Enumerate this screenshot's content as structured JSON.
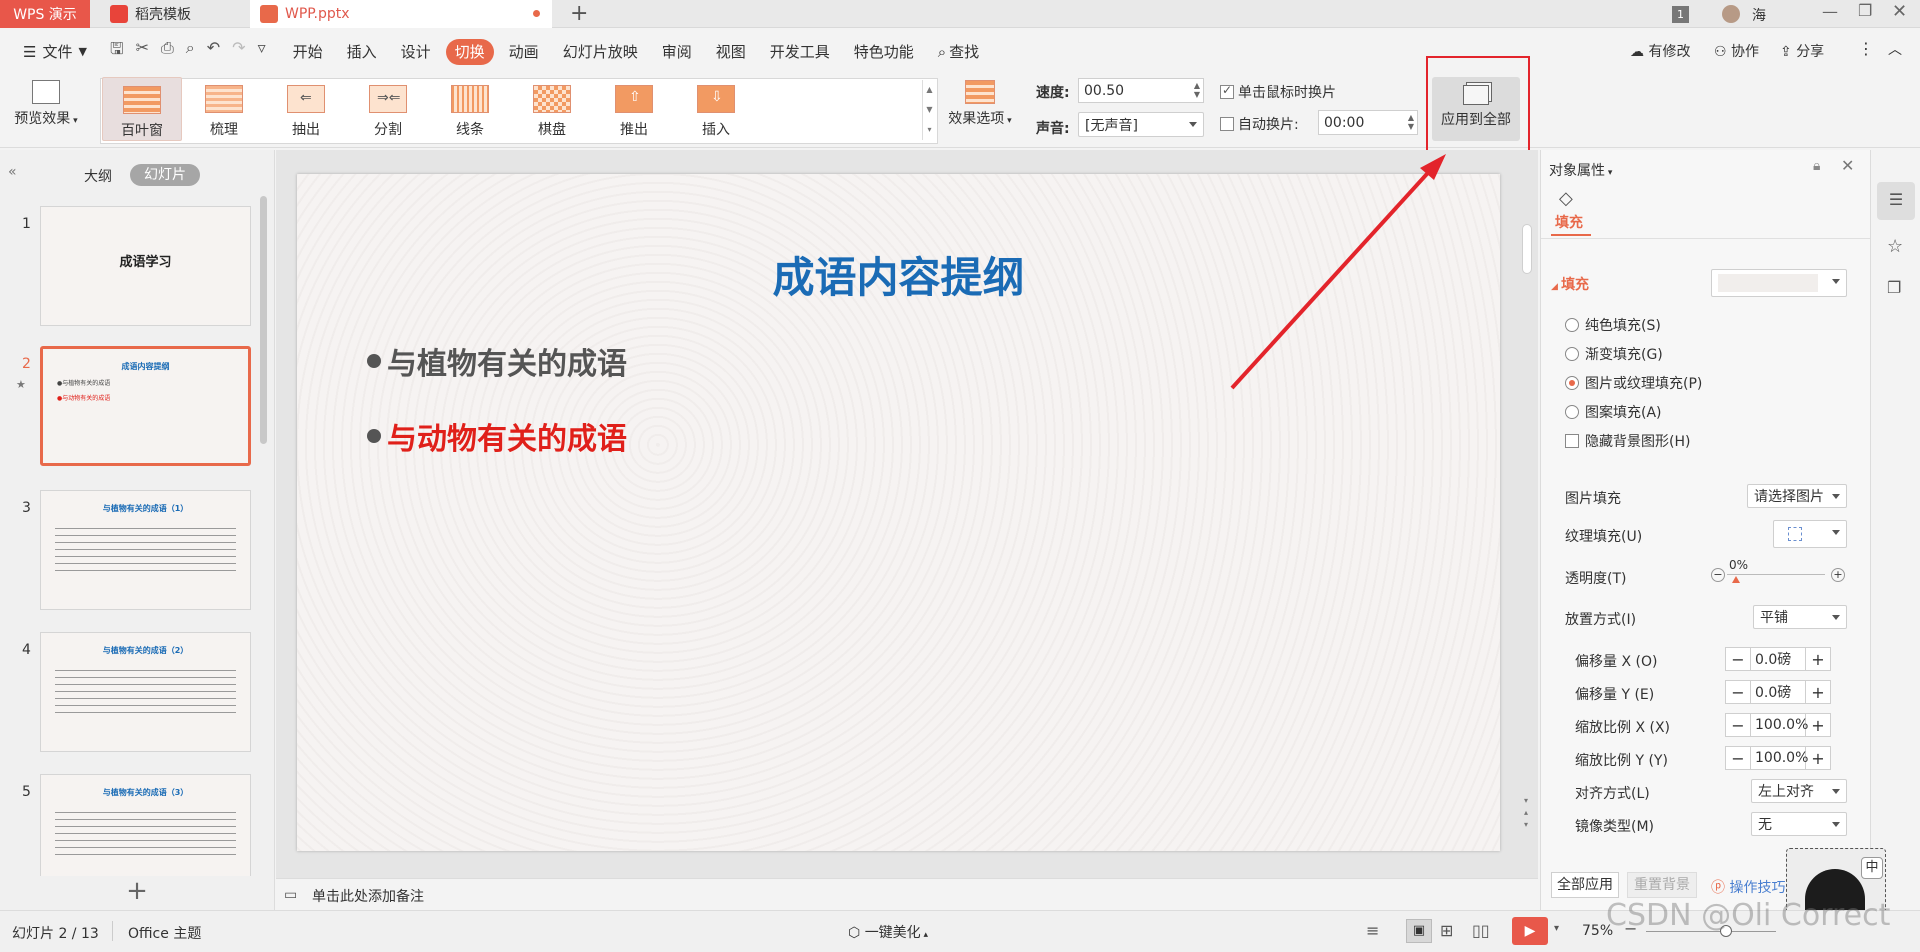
{
  "titlebar": {
    "wps_tab": "WPS 演示",
    "template_tab": "稻壳模板",
    "doc_tab": "WPP.pptx",
    "new_tab": "+",
    "user_badge": "1",
    "user_name": "海"
  },
  "menubar": {
    "file": "文件",
    "tabs": [
      "开始",
      "插入",
      "设计",
      "切换",
      "动画",
      "幻灯片放映",
      "审阅",
      "视图",
      "开发工具",
      "特色功能"
    ],
    "active_tab": "切换",
    "search": "查找",
    "changes": "有修改",
    "collab": "协作",
    "share": "分享"
  },
  "ribbon": {
    "preview": "预览效果",
    "effects": [
      "百叶窗",
      "梳理",
      "抽出",
      "分割",
      "线条",
      "棋盘",
      "推出",
      "插入"
    ],
    "selected_effect": "百叶窗",
    "effect_options": "效果选项",
    "speed_label": "速度:",
    "speed_value": "00.50",
    "sound_label": "声音:",
    "sound_value": "[无声音]",
    "on_click_label": "单击鼠标时换片",
    "on_click_checked": true,
    "auto_label": "自动换片:",
    "auto_value": "00:00",
    "apply_all": "应用到全部"
  },
  "left_panel": {
    "tab_outline": "大纲",
    "tab_slides": "幻灯片",
    "slides": [
      {
        "num": "1",
        "title": "成语学习"
      },
      {
        "num": "2",
        "title": "成语内容提纲",
        "lines": [
          "●与植物有关的成语",
          "●与动物有关的成语"
        ]
      },
      {
        "num": "3",
        "title": "与植物有关的成语（1）"
      },
      {
        "num": "4",
        "title": "与植物有关的成语（2）"
      },
      {
        "num": "5",
        "title": "与植物有关的成语（3）"
      }
    ],
    "add_slide": "+"
  },
  "slide": {
    "title": "成语内容提纲",
    "bullet1": "与植物有关的成语",
    "bullet2": "与动物有关的成语",
    "title_color": "#1a6bb5",
    "bullet1_color": "#555555",
    "bullet2_color": "#e0201a"
  },
  "notes": {
    "placeholder": "单击此处添加备注"
  },
  "right_panel": {
    "header": "对象属性",
    "fill_tab": "填充",
    "fill_section": "填充",
    "options": [
      "纯色填充(S)",
      "渐变填充(G)",
      "图片或纹理填充(P)",
      "图案填充(A)"
    ],
    "selected_option": "图片或纹理填充(P)",
    "hide_bg": "隐藏背景图形(H)",
    "picture_fill_label": "图片填充",
    "picture_fill_value": "请选择图片",
    "texture_fill_label": "纹理填充(U)",
    "transparency_label": "透明度(T)",
    "transparency_value": "0%",
    "placement_label": "放置方式(I)",
    "placement_value": "平铺",
    "offset_x_label": "偏移量 X (O)",
    "offset_x_value": "0.0磅",
    "offset_y_label": "偏移量 Y (E)",
    "offset_y_value": "0.0磅",
    "scale_x_label": "缩放比例 X (X)",
    "scale_x_value": "100.0%",
    "scale_y_label": "缩放比例 Y (Y)",
    "scale_y_value": "100.0%",
    "align_label": "对齐方式(L)",
    "align_value": "左上对齐",
    "mirror_label": "镜像类型(M)",
    "mirror_value": "无",
    "apply_all": "全部应用",
    "reset_bg": "重置背景",
    "tips": "操作技巧"
  },
  "statusbar": {
    "slide_info": "幻灯片 2 / 13",
    "theme": "Office 主题",
    "beautify": "一键美化",
    "zoom": "75%"
  },
  "watermark": "CSDN @Oli Correct",
  "ime": "中"
}
